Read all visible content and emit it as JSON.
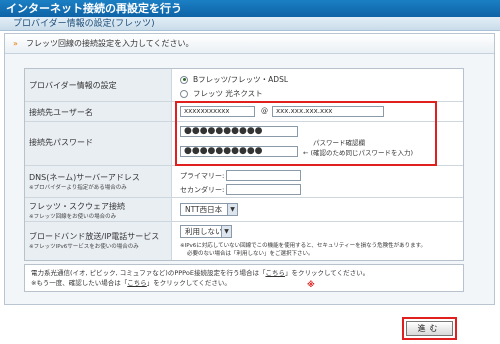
{
  "header": {
    "title": "インターネット接続の再設定を行う",
    "subtitle": "プロバイダー情報の設定(フレッツ)"
  },
  "panel": {
    "instruction": "フレッツ回線の接続設定を入力してください。"
  },
  "form": {
    "provider_info": {
      "label": "プロバイダー情報の設定",
      "options": [
        "Bフレッツ/フレッツ・ADSL",
        "フレッツ 光ネクスト"
      ],
      "selected": 0
    },
    "username": {
      "label": "接続先ユーザー名",
      "user_value": "xxxxxxxxxxx",
      "at": "@",
      "domain_value": "xxx.xxx.xxx.xxx"
    },
    "password": {
      "label": "接続先パスワード",
      "value": "●●●●●●●●●●",
      "confirm_value": "●●●●●●●●●●",
      "confirm_label": "パスワード確認欄",
      "confirm_note": "← (確認のため同じパスワードを入力)"
    },
    "dns": {
      "label": "DNS(ネーム)サーバーアドレス",
      "note": "※プロバイダーより指定がある場合のみ",
      "primary_label": "プライマリー:",
      "secondary_label": "セカンダリー:"
    },
    "flets_square": {
      "label": "フレッツ・スクウェア接続",
      "note": "※フレッツ回線をお使いの場合のみ",
      "value": "NTT西日本"
    },
    "broadband": {
      "label": "ブロードバンド放送/IP電話サービス",
      "note": "※フレッツIPv6サービスをお使いの場合のみ",
      "value": "利用しない",
      "note1": "※IPv6に対応していない回線でこの機能を使用すると、セキュリティーを損なう危険性があります。",
      "note2": "必要のない場合は「利用しない」をご選択下さい。"
    }
  },
  "notice": {
    "line1_pre": "電力系光通信(イオ, ピビック, コミュファなど)のPPPoE接続設定を行う場合は「",
    "line1_link": "こちら",
    "line1_post": "」をクリックしてください。",
    "line2_pre": "※もう一度、確認したい場合は「",
    "line2_link": "こちら",
    "line2_post": "」をクリックしてください。",
    "asterisk": "※"
  },
  "next_button": {
    "label": "進む"
  },
  "colors": {
    "title_bg": "#0e63a6",
    "highlight": "#e01f1f"
  }
}
